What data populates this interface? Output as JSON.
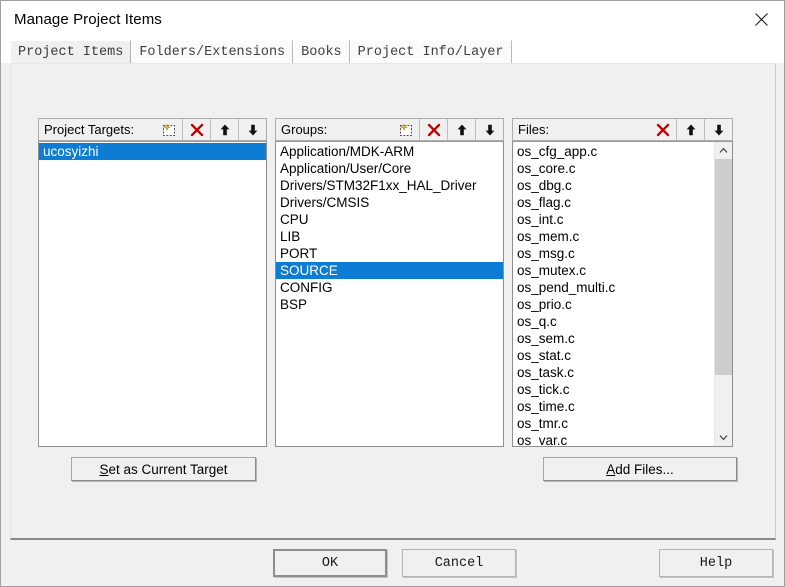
{
  "window": {
    "title": "Manage Project Items",
    "close_icon": "close-icon"
  },
  "tabs": [
    {
      "label": "Project Items",
      "active": true
    },
    {
      "label": "Folders/Extensions",
      "active": false
    },
    {
      "label": "Books",
      "active": false
    },
    {
      "label": "Project Info/Layer",
      "active": false
    }
  ],
  "colors": {
    "selection_blue": "#0c7cd5",
    "delete_red": "#c00000",
    "dialog_face": "#f0f0f0",
    "listbox_white": "#ffffff"
  },
  "panels": {
    "targets": {
      "label": "Project Targets:",
      "icons": [
        "new-item-icon",
        "delete-icon",
        "move-up-icon",
        "move-down-icon"
      ],
      "items": [
        "ucosyizhi"
      ],
      "selected": "ucosyizhi"
    },
    "groups": {
      "label": "Groups:",
      "icons": [
        "new-item-icon",
        "delete-icon",
        "move-up-icon",
        "move-down-icon"
      ],
      "items": [
        "Application/MDK-ARM",
        "Application/User/Core",
        "Drivers/STM32F1xx_HAL_Driver",
        "Drivers/CMSIS",
        "CPU",
        "LIB",
        "PORT",
        "SOURCE",
        "CONFIG",
        "BSP"
      ],
      "selected": "SOURCE"
    },
    "files": {
      "label": "Files:",
      "icons": [
        "delete-icon",
        "move-up-icon",
        "move-down-icon"
      ],
      "items": [
        "os_cfg_app.c",
        "os_core.c",
        "os_dbg.c",
        "os_flag.c",
        "os_int.c",
        "os_mem.c",
        "os_msg.c",
        "os_mutex.c",
        "os_pend_multi.c",
        "os_prio.c",
        "os_q.c",
        "os_sem.c",
        "os_stat.c",
        "os_task.c",
        "os_tick.c",
        "os_time.c",
        "os_tmr.c",
        "os_var.c"
      ],
      "selected": null,
      "scrollbar": {
        "up_icon": "chevron-up-icon",
        "down_icon": "chevron-down-icon",
        "thumb_size_pct": 80,
        "thumb_position_pct": 0
      }
    }
  },
  "actions": {
    "set_current_target": {
      "accel": "S",
      "rest": "et as Current Target"
    },
    "add_files": {
      "accel": "A",
      "rest": "dd Files..."
    }
  },
  "dialog_buttons": {
    "ok": "OK",
    "cancel": "Cancel",
    "help": "Help",
    "default": "OK"
  }
}
